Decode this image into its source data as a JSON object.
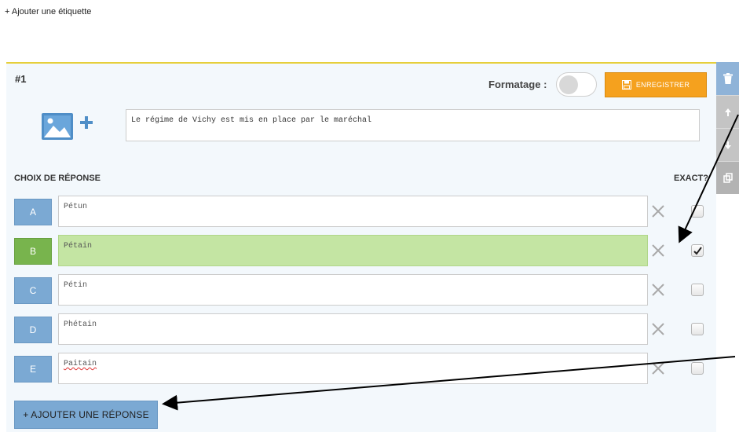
{
  "top": {
    "add_label": "+ Ajouter une étiquette"
  },
  "question": {
    "number": "#1",
    "format_label": "Formatage :",
    "format_enabled": false,
    "save_label": "ENREGISTRER",
    "text": "Le régime de Vichy est mis en place par le maréchal"
  },
  "side_tools": [
    "trash-icon",
    "arrow-up-icon",
    "arrow-down-icon",
    "copy-icon"
  ],
  "choices": {
    "title": "CHOIX DE RÉPONSE",
    "exact_title": "EXACT?",
    "items": [
      {
        "letter": "A",
        "text": "Pétun",
        "correct": false
      },
      {
        "letter": "B",
        "text": "Pétain",
        "correct": true
      },
      {
        "letter": "C",
        "text": "Pétin",
        "correct": false
      },
      {
        "letter": "D",
        "text": "Phétain",
        "correct": false
      },
      {
        "letter": "E",
        "text": "Paitain",
        "correct": false
      }
    ],
    "add_answer_label": "+ AJOUTER UNE RÉPONSE"
  },
  "colors": {
    "accent_orange": "#f5a11e",
    "letter_blue": "#7ba9d3",
    "correct_green": "#c4e5a3",
    "top_border": "#e6cf3a"
  }
}
